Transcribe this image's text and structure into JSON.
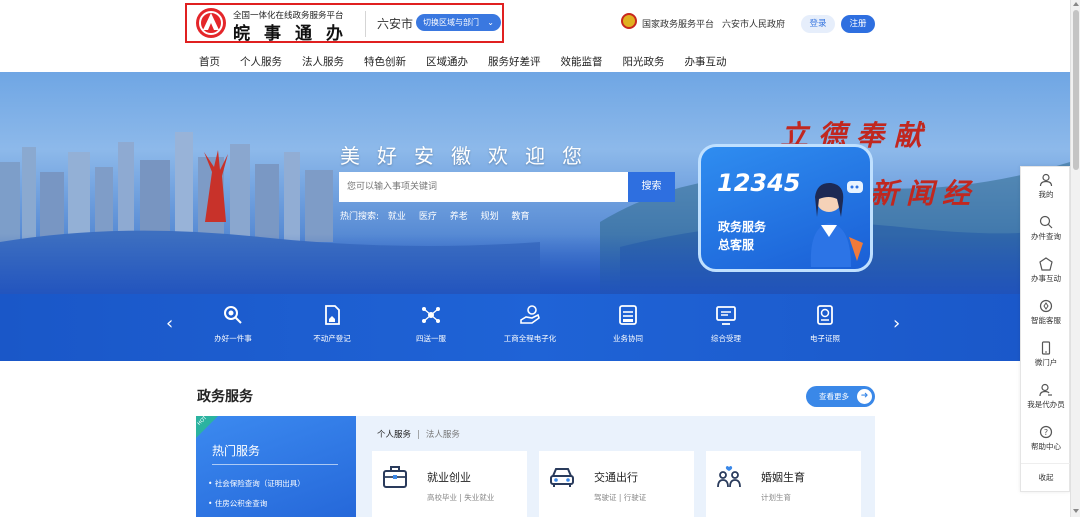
{
  "header": {
    "logo_subtitle": "全国一体化在线政务服务平台",
    "logo_title": "皖事通办",
    "city": "六安市",
    "switch_label": "切换区域与部门",
    "national_platform": "国家政务服务平台",
    "city_gov": "六安市人民政府",
    "login": "登录",
    "register": "注册"
  },
  "nav": [
    "首页",
    "个人服务",
    "法人服务",
    "特色创新",
    "区域通办",
    "服务好差评",
    "效能监督",
    "阳光政务",
    "办事互动"
  ],
  "banner": {
    "slogan": "美好安徽欢迎您",
    "search_placeholder": "您可以输入事项关键词",
    "search_button": "搜索",
    "hot_label": "热门搜索:",
    "hot_keywords": [
      "就业",
      "医疗",
      "养老",
      "规划",
      "教育"
    ],
    "calligraphy_1": "立德奉献",
    "calligraphy_2": "新闻经",
    "hotline_number": "12345",
    "hotline_line1": "政务服务",
    "hotline_line2": "总客服"
  },
  "service_strip": {
    "items": [
      {
        "label": "办好一件事",
        "icon": "search-doc-icon"
      },
      {
        "label": "不动产登记",
        "icon": "house-doc-icon"
      },
      {
        "label": "四送一服",
        "icon": "network-icon"
      },
      {
        "label": "工商全程电子化",
        "icon": "hand-coin-icon"
      },
      {
        "label": "业务协同",
        "icon": "printer-icon"
      },
      {
        "label": "综合受理",
        "icon": "monitor-icon"
      },
      {
        "label": "电子证照",
        "icon": "id-card-icon"
      }
    ]
  },
  "gov_services": {
    "title": "政务服务",
    "more": "查看更多",
    "hot_badge": "HOT",
    "hot_title": "热门服务",
    "hot_links": [
      "社会保险查询（证明出具）",
      "住房公积金查询"
    ],
    "tabs": [
      "个人服务",
      "法人服务"
    ],
    "cards": [
      {
        "title": "就业创业",
        "sub": "高校毕业 | 失业就业",
        "icon": "briefcase-icon"
      },
      {
        "title": "交通出行",
        "sub": "驾驶证 | 行驶证",
        "icon": "car-icon"
      },
      {
        "title": "婚姻生育",
        "sub": "计划生育",
        "icon": "family-icon"
      }
    ]
  },
  "side_bar": {
    "items": [
      "我的",
      "办件查询",
      "办事互动",
      "智能客服",
      "微门户",
      "我是代办员",
      "帮助中心"
    ],
    "collapse": "收起"
  },
  "colors": {
    "primary": "#2e6fe0",
    "highlight_border": "#e02020",
    "strip_bg": "#1f63d6"
  }
}
